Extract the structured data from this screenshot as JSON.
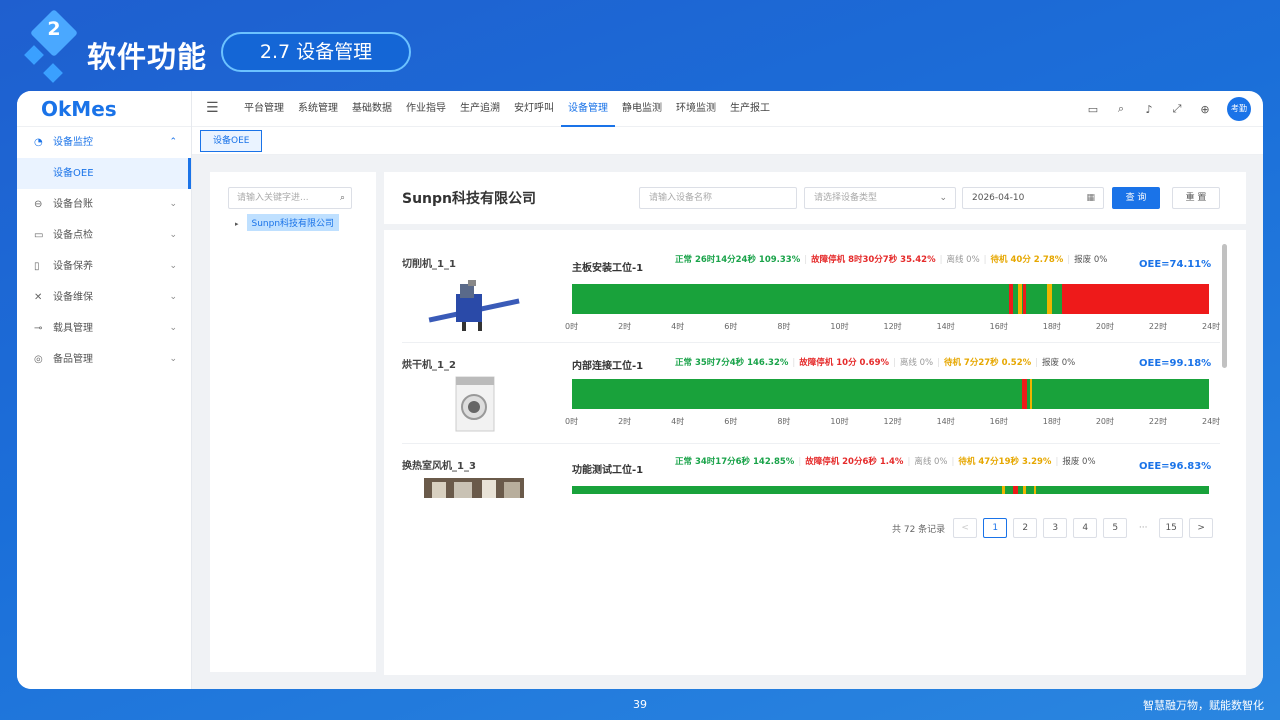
{
  "slide": {
    "number": "2",
    "title": "软件功能",
    "section": "2.7 设备管理",
    "page_number": "39",
    "slogan": "智慧融万物，赋能数智化"
  },
  "app": {
    "logo": "OkMes",
    "sidebar": {
      "items": [
        {
          "label": "设备监控",
          "icon": "monitor-icon",
          "expanded": true
        },
        {
          "label": "设备台账",
          "icon": "ledger-icon"
        },
        {
          "label": "设备点检",
          "icon": "inspect-icon"
        },
        {
          "label": "设备保养",
          "icon": "maintain-icon"
        },
        {
          "label": "设备维保",
          "icon": "wrench-icon"
        },
        {
          "label": "载具管理",
          "icon": "carrier-icon"
        },
        {
          "label": "备品管理",
          "icon": "spare-icon"
        }
      ],
      "submenu_active": "设备OEE"
    },
    "nav": {
      "tabs": [
        "平台管理",
        "系统管理",
        "基础数据",
        "作业指导",
        "生产追溯",
        "安灯呼叫",
        "设备管理",
        "静电监测",
        "环境监测",
        "生产报工"
      ],
      "active_tab": "设备管理",
      "avatar_text": "考勤"
    },
    "open_tag": "设备OEE",
    "tree": {
      "search_placeholder": "请输入关键字进...",
      "node": "Sunpn科技有限公司"
    },
    "filter": {
      "company": "Sunpn科技有限公司",
      "device_name_placeholder": "请输入设备名称",
      "device_type_placeholder": "请选择设备类型",
      "date": "2026-04-10",
      "query_label": "查 询",
      "reset_label": "重 置"
    },
    "axis_ticks": [
      "0时",
      "2时",
      "4时",
      "6时",
      "8时",
      "10时",
      "12时",
      "14时",
      "16时",
      "18时",
      "20时",
      "22时",
      "24时"
    ],
    "devices": [
      {
        "name": "切削机_1_1",
        "station": "主板安装工位-1",
        "normal": "正常 26时14分24秒 109.33%",
        "fault": "故障停机 8时30分7秒 35.42%",
        "offline": "离线 0%",
        "wait": "待机 40分 2.78%",
        "scrap": "报废 0%",
        "oee": "OEE=74.11%",
        "segments": [
          {
            "start": 16.45,
            "end": 16.6,
            "status": "fault"
          },
          {
            "start": 16.8,
            "end": 16.95,
            "status": "wait"
          },
          {
            "start": 17.0,
            "end": 17.1,
            "status": "fault"
          },
          {
            "start": 17.9,
            "end": 18.1,
            "status": "wait"
          },
          {
            "start": 18.45,
            "end": 24.0,
            "status": "fault"
          }
        ]
      },
      {
        "name": "烘干机_1_2",
        "station": "内部连接工位-1",
        "normal": "正常 35时7分4秒 146.32%",
        "fault": "故障停机 10分 0.69%",
        "offline": "离线 0%",
        "wait": "待机 7分27秒 0.52%",
        "scrap": "报废 0%",
        "oee": "OEE=99.18%",
        "segments": [
          {
            "start": 16.95,
            "end": 17.15,
            "status": "fault"
          },
          {
            "start": 17.25,
            "end": 17.35,
            "status": "wait"
          }
        ]
      },
      {
        "name": "换热室风机_1_3",
        "station": "功能测试工位-1",
        "normal": "正常 34时17分6秒 142.85%",
        "fault": "故障停机 20分6秒 1.4%",
        "offline": "离线 0%",
        "wait": "待机 47分19秒 3.29%",
        "scrap": "报废 0%",
        "oee": "OEE=96.83%",
        "segments": [
          {
            "start": 16.2,
            "end": 16.3,
            "status": "wait"
          },
          {
            "start": 16.6,
            "end": 16.8,
            "status": "fault"
          },
          {
            "start": 17.0,
            "end": 17.1,
            "status": "wait"
          },
          {
            "start": 17.4,
            "end": 17.5,
            "status": "wait"
          }
        ]
      }
    ],
    "status_colors": {
      "normal": "#19a23b",
      "fault": "#ee1a1a",
      "wait": "#f0b400",
      "offline": "#bbbbbb"
    },
    "pagination": {
      "total": "共 72 条记录",
      "pages": [
        "1",
        "2",
        "3",
        "4",
        "5"
      ],
      "last": "15",
      "current": "1"
    }
  }
}
